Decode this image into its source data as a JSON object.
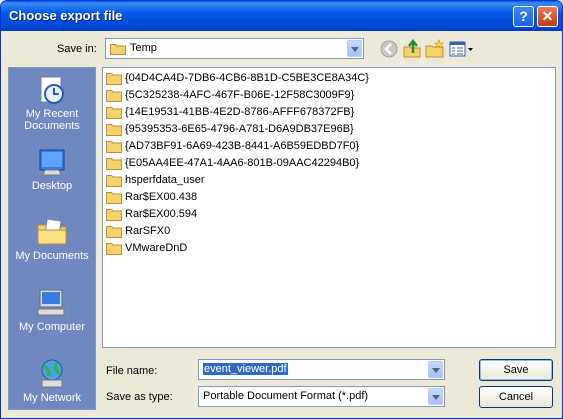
{
  "dialog": {
    "title": "Choose export file",
    "help_glyph": "?",
    "close_glyph": "✕"
  },
  "toolbar": {
    "save_in_label": "Save in:",
    "save_in_value": "Temp",
    "icons": [
      "back-icon",
      "up-folder-icon",
      "new-folder-icon",
      "views-menu-icon"
    ]
  },
  "places": [
    {
      "label": "My Recent Documents",
      "icon": "recent-documents-icon"
    },
    {
      "label": "Desktop",
      "icon": "desktop-icon"
    },
    {
      "label": "My Documents",
      "icon": "my-documents-icon"
    },
    {
      "label": "My Computer",
      "icon": "my-computer-icon"
    },
    {
      "label": "My Network",
      "icon": "my-network-icon"
    }
  ],
  "files": [
    "{04D4CA4D-7DB6-4CB6-8B1D-C5BE3CE8A34C}",
    "{5C325238-4AFC-467F-B06E-12F58C3009F9}",
    "{14E19531-41BB-4E2D-8786-AFFF678372FB}",
    "{95395353-6E65-4796-A781-D6A9DB37E96B}",
    "{AD73BF91-6A69-423B-8441-A6B59EDBD7F0}",
    "{E05AA4EE-47A1-4AA6-801B-09AAC42294B0}",
    "hsperfdata_user",
    "Rar$EX00.438",
    "Rar$EX00.594",
    "RarSFX0",
    "VMwareDnD"
  ],
  "form": {
    "file_name_label": "File name:",
    "file_name_value": "event_viewer.pdf",
    "save_as_type_label": "Save as type:",
    "save_as_type_value": "Portable Document Format (*.pdf)",
    "save_button": "Save",
    "cancel_button": "Cancel"
  },
  "colors": {
    "titlebar": "#0058e6",
    "places_bar": "#6f88bf",
    "selection": "#316ac5",
    "folder": "#f5d36b"
  }
}
